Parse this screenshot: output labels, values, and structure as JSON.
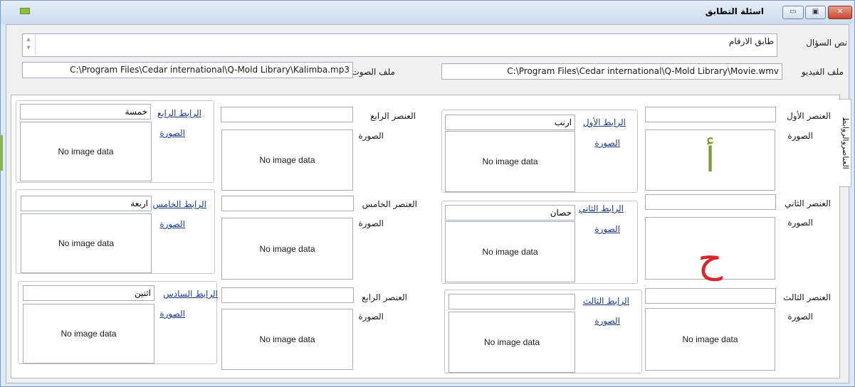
{
  "window": {
    "title": "اسئلة التطابق",
    "buttons": {
      "close": "✕",
      "maximize": "▣",
      "minimize": "▭"
    }
  },
  "header": {
    "question_label": "نص السؤال",
    "question_value": "طابق الارقام",
    "video_label": "ملف الفيديو",
    "video_path": "C:\\Program Files\\Cedar international\\Q-Mold Library\\Movie.wmv",
    "sound_label": "ملف الصوت",
    "sound_path": "C:\\Program Files\\Cedar international\\Q-Mold Library\\Kalimba.mp3"
  },
  "tab": {
    "label": "العناصروالروابط"
  },
  "no_image": "No image data",
  "image_label": "الصورة",
  "elements": [
    {
      "label": "العنصر الأول",
      "value": "",
      "glyph": "أ",
      "glyph_color": "#79a030"
    },
    {
      "label": "العنصر الثاني",
      "value": "",
      "glyph": "ح",
      "glyph_color": "#d8262a"
    },
    {
      "label": "العنصر الثالث",
      "value": ""
    },
    {
      "label": "العنصر الرابع",
      "value": ""
    },
    {
      "label": "العنصر الخامس",
      "value": ""
    },
    {
      "label": "العنصر الرابع",
      "value": ""
    }
  ],
  "links": [
    {
      "label": "الرابط الأول",
      "value": "ارنب"
    },
    {
      "label": "الرابط الثاني",
      "value": "حصان"
    },
    {
      "label": "الرابط الثالث",
      "value": ""
    },
    {
      "label": "الرابط الرابع",
      "value": "خمسة"
    },
    {
      "label": "الرابط الخامس",
      "value": "اربعة"
    },
    {
      "label": "الرابط السادس",
      "value": "اثنين"
    }
  ],
  "colors": {
    "title_gradient_top": "#e4edf8",
    "close_button": "#c64a30",
    "accent_green": "#8bb64a"
  }
}
